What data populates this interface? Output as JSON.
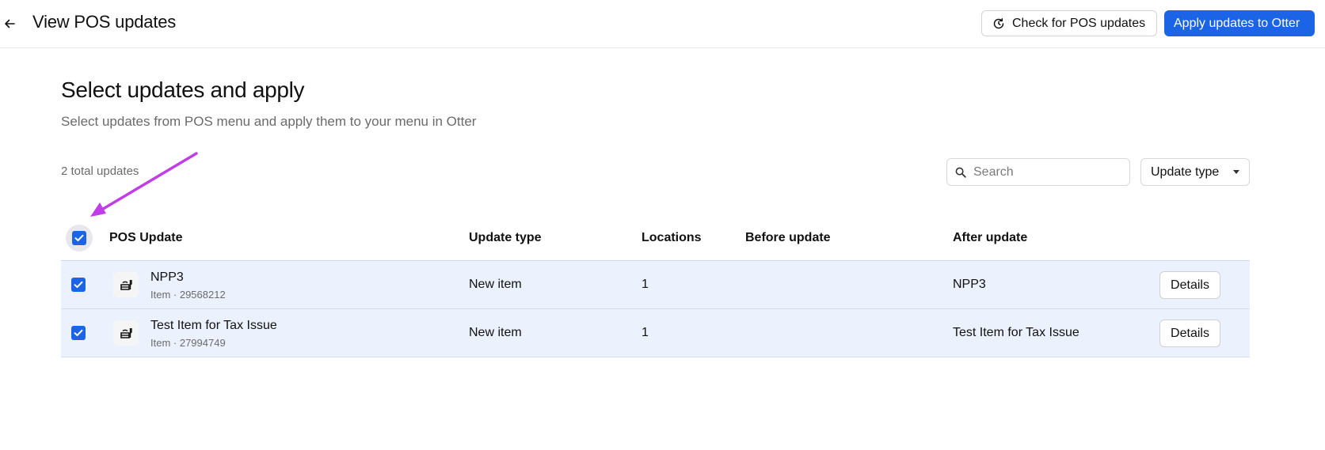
{
  "header": {
    "title": "View POS updates",
    "back_icon": "arrow-left-icon",
    "check_updates_label": "Check for POS updates",
    "apply_label": "Apply updates to Otter"
  },
  "section": {
    "title": "Select updates and apply",
    "subtitle": "Select updates from POS menu and apply them to your menu in Otter",
    "total_label": "2 total updates"
  },
  "search": {
    "placeholder": "Search",
    "value": ""
  },
  "filter": {
    "label": "Update type"
  },
  "table": {
    "columns": {
      "pos_update": "POS Update",
      "update_type": "Update type",
      "locations": "Locations",
      "before_update": "Before update",
      "after_update": "After update"
    },
    "select_all_checked": true,
    "rows": [
      {
        "checked": true,
        "name": "NPP3",
        "meta": "Item · 29568212",
        "update_type": "New item",
        "locations": "1",
        "before_update": "",
        "after_update": "NPP3",
        "details_label": "Details"
      },
      {
        "checked": true,
        "name": "Test Item for Tax Issue",
        "meta": "Item · 27994749",
        "update_type": "New item",
        "locations": "1",
        "before_update": "",
        "after_update": "Test Item for Tax Issue",
        "details_label": "Details"
      }
    ]
  },
  "colors": {
    "primary": "#1a64e5",
    "row_selected": "#ebf1fd",
    "annotation_arrow": "#c03ee8"
  }
}
